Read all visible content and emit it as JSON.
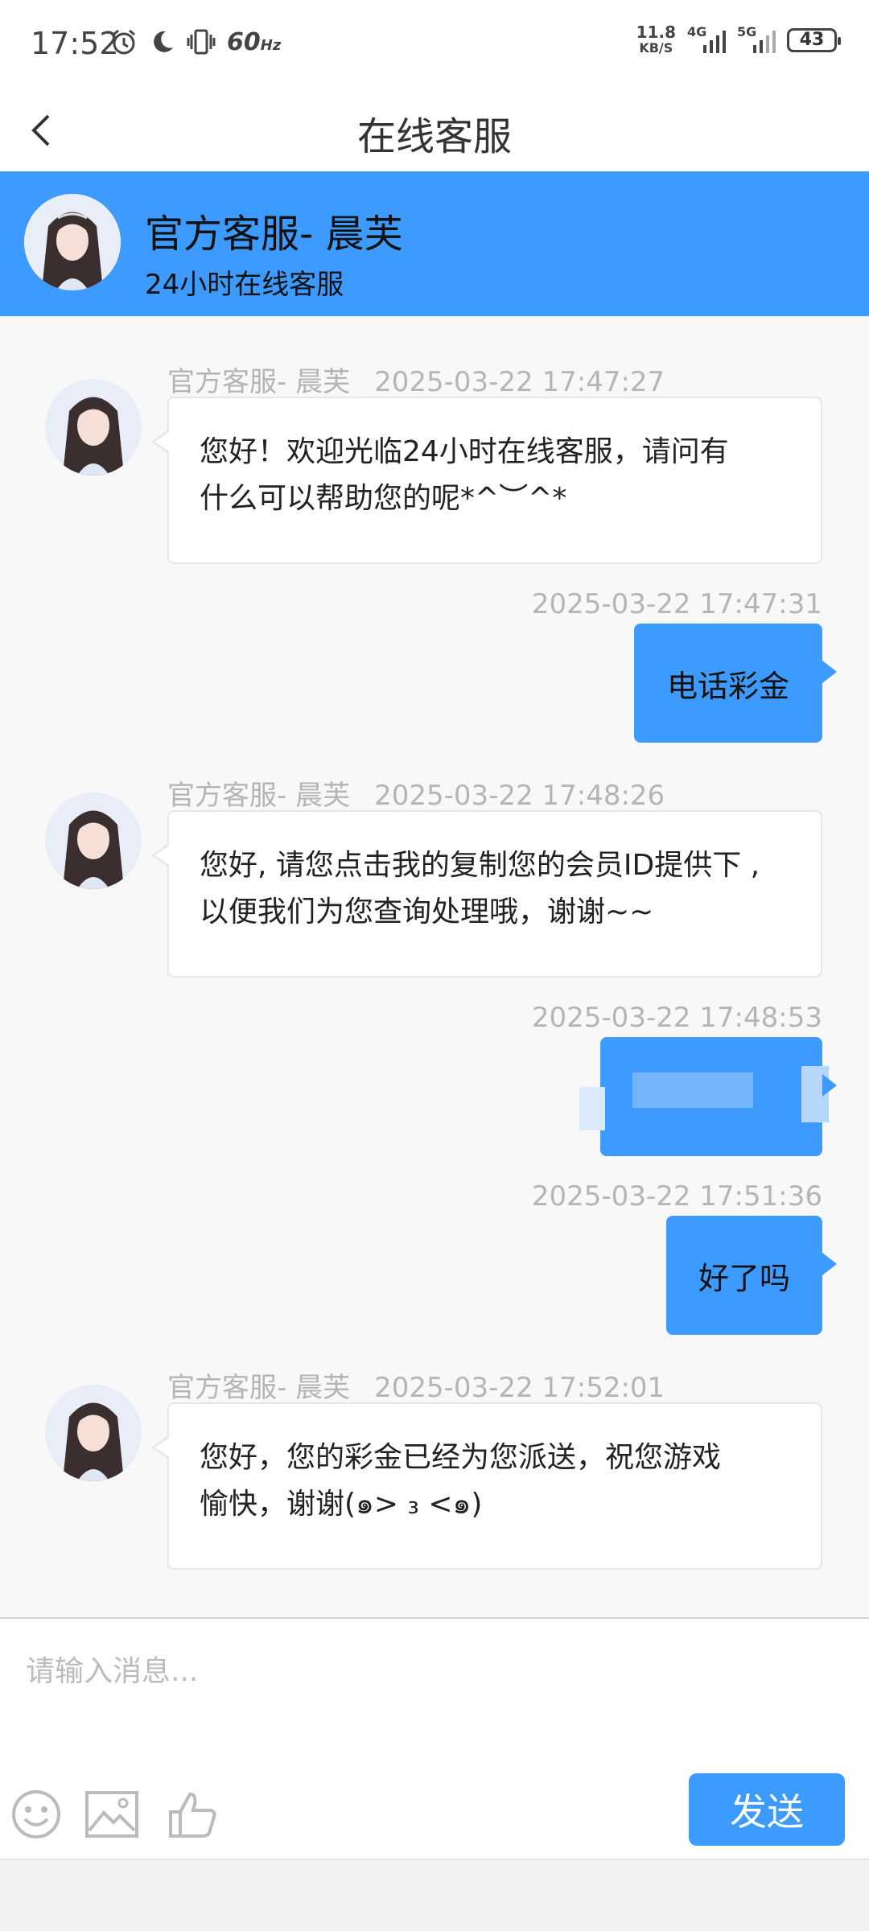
{
  "status_bar": {
    "time": "17:52",
    "refresh_rate": "60",
    "refresh_unit": "Hz",
    "net_speed_value": "11.8",
    "net_speed_unit": "KB/S",
    "sim1_label": "4G",
    "sim2_label": "5G",
    "battery": "43",
    "icons": [
      "alarm-icon",
      "moon-icon",
      "vibrate-icon"
    ]
  },
  "nav": {
    "title": "在线客服",
    "back_icon": "chevron-left-icon"
  },
  "agent": {
    "name": "官方客服- 晨芙",
    "subtitle": "24小时在线客服"
  },
  "messages": [
    {
      "direction": "in",
      "sender": "官方客服- 晨芙",
      "time": "2025-03-22 17:47:27",
      "text_lines": [
        "您好！欢迎光临24小时在线客服，请问有",
        "什么可以帮助您的呢*^︶^*"
      ]
    },
    {
      "direction": "out",
      "time": "2025-03-22 17:47:31",
      "text": "电话彩金"
    },
    {
      "direction": "in",
      "sender": "官方客服- 晨芙",
      "time": "2025-03-22 17:48:26",
      "text_lines": [
        "您好, 请您点击我的复制您的会员ID提供下 ,",
        "以便我们为您查询处理哦，谢谢~~"
      ]
    },
    {
      "direction": "out",
      "time": "2025-03-22 17:48:53",
      "text": ""
    },
    {
      "direction": "out",
      "time": "2025-03-22 17:51:36",
      "text": "好了吗"
    },
    {
      "direction": "in",
      "sender": "官方客服- 晨芙",
      "time": "2025-03-22 17:52:01",
      "text_lines": [
        "您好，您的彩金已经为您派送，祝您游戏",
        "愉快，谢谢(๑> ₃ <๑)"
      ]
    }
  ],
  "input": {
    "placeholder": "请输入消息...",
    "value": "",
    "send_label": "发送",
    "tools": [
      "emoji-icon",
      "image-icon",
      "thumbs-up-icon"
    ]
  },
  "colors": {
    "accent": "#3d9bff",
    "bubble_in": "#ffffff",
    "meta_text": "#b5b5b5"
  }
}
